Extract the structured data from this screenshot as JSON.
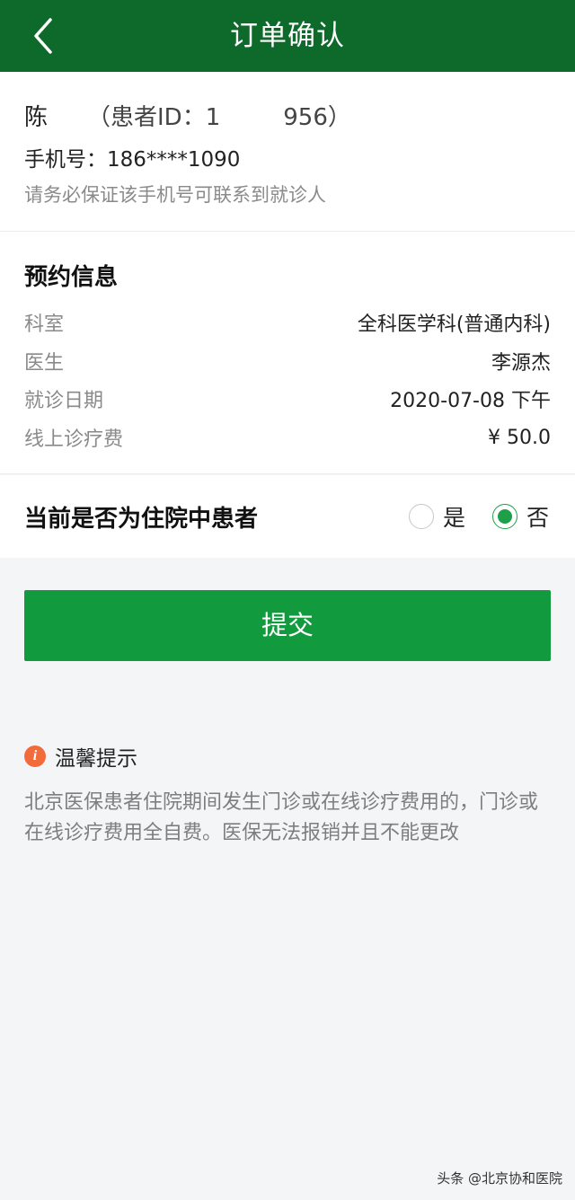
{
  "header": {
    "title": "订单确认",
    "back_icon": "chevron-left-icon"
  },
  "patient": {
    "name": "陈",
    "id_prefix": "（患者ID：",
    "id_visible_head": "1",
    "id_visible_tail": "956",
    "id_suffix": "）",
    "phone_label": "手机号：",
    "phone_value": "186****1090",
    "phone_hint": "请务必保证该手机号可联系到就诊人"
  },
  "appointment": {
    "title": "预约信息",
    "rows": [
      {
        "label": "科室",
        "value": "全科医学科(普通内科)"
      },
      {
        "label": "医生",
        "value": "李源杰"
      },
      {
        "label": "就诊日期",
        "value": "2020-07-08 下午"
      },
      {
        "label": "线上诊疗费",
        "value": "¥ 50.0"
      }
    ]
  },
  "inpatient": {
    "question": "当前是否为住院中患者",
    "options": [
      {
        "label": "是",
        "checked": false
      },
      {
        "label": "否",
        "checked": true
      }
    ]
  },
  "submit": {
    "label": "提交"
  },
  "tips": {
    "icon": "info-icon",
    "icon_glyph": "i",
    "title": "温馨提示",
    "body": "北京医保患者住院期间发生门诊或在线诊疗费用的，门诊或在线诊疗费用全自费。医保无法报销并且不能更改"
  },
  "watermark": "头条 @北京协和医院",
  "colors": {
    "header_bg": "#0d6a2a",
    "button_bg": "#129a3e",
    "radio_checked": "#1ea04a",
    "info_icon": "#f26b3a"
  }
}
